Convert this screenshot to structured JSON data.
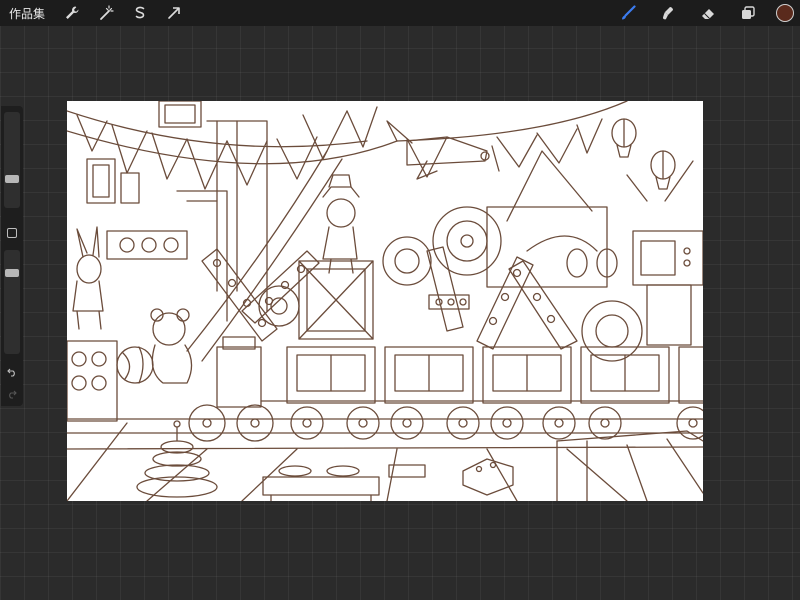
{
  "topbar": {
    "gallery_label": "作品集",
    "left_tools": [
      {
        "name": "actions-wrench-icon"
      },
      {
        "name": "adjustments-wand-icon"
      },
      {
        "name": "selection-icon"
      },
      {
        "name": "transform-arrow-icon"
      }
    ],
    "right_tools": [
      {
        "name": "brush-icon",
        "color": "#3b7cf0"
      },
      {
        "name": "smudge-icon",
        "color": "#d8d8d8"
      },
      {
        "name": "eraser-icon",
        "color": "#d8d8d8"
      },
      {
        "name": "layers-icon",
        "color": "#d8d8d8"
      }
    ],
    "current_color": "#5a2a1c"
  },
  "sidebar": {
    "brush_size_level": 0.72,
    "opacity_level": 0.2
  },
  "canvas": {
    "stroke_color": "#6b4c3b",
    "background": "#ffffff"
  }
}
